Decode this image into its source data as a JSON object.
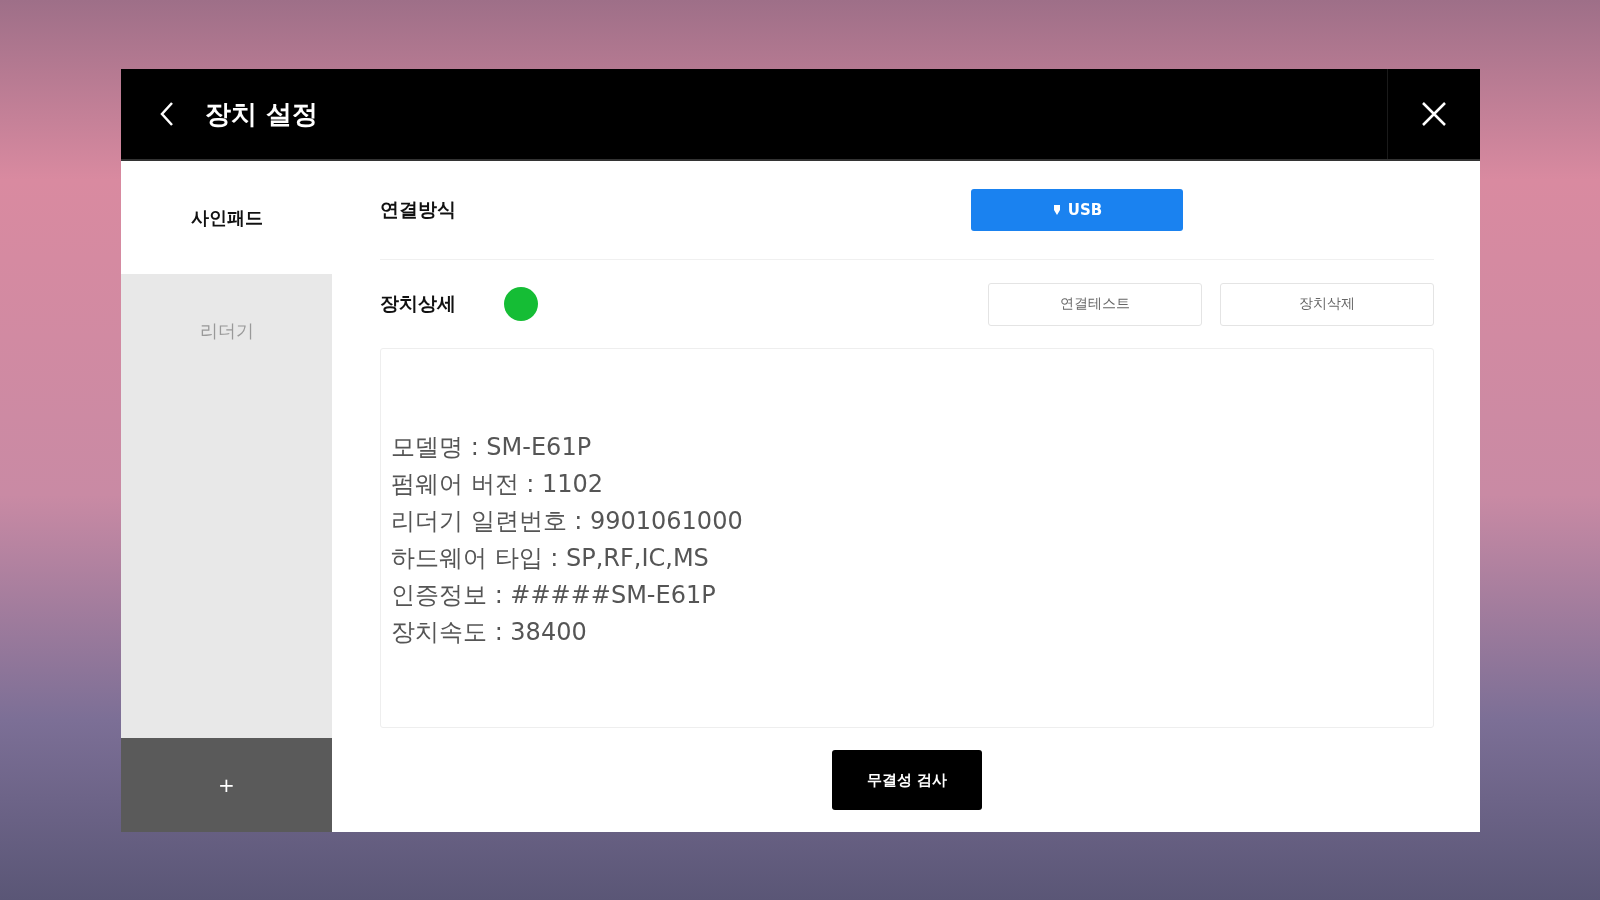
{
  "window": {
    "title": "장치 설정"
  },
  "sidebar": {
    "items": [
      {
        "label": "사인패드",
        "selected": true
      },
      {
        "label": "리더기",
        "selected": false
      }
    ],
    "add_button": "+"
  },
  "connection": {
    "label": "연결방식",
    "button": "USB"
  },
  "device": {
    "label": "장치상세",
    "connected": true,
    "buttons": [
      "연결테스트",
      "장치삭제"
    ],
    "details": [
      "모델명 : SM-E61P",
      "펌웨어 버전 : 1102",
      "리더기 일련번호 : 9901061000",
      "하드웨어 타입 : SP,RF,IC,MS",
      "인증정보 : #####SM-E61P",
      "장치속도 : 38400"
    ]
  },
  "footer_button": "무결성 검사"
}
